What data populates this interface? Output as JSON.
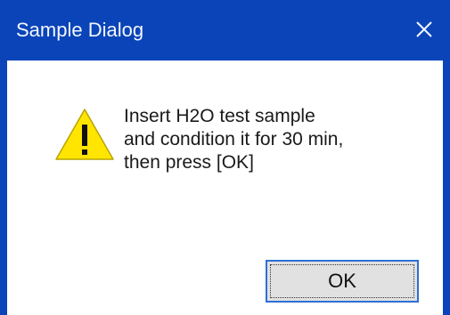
{
  "dialog": {
    "title": "Sample Dialog",
    "close_icon": "close-icon",
    "warning_icon": "warning-icon",
    "message_lines": [
      "Insert H2O test sample",
      "and condition it for 30 min,",
      "then press [OK]"
    ],
    "ok_label": "OK"
  },
  "colors": {
    "titlebar": "#0a44b8",
    "title_text": "#f2f6ff",
    "warning_fill": "#ffe500",
    "warning_symbol": "#111111",
    "button_border": "#2c6fd6",
    "button_bg": "#e1e1e1"
  }
}
